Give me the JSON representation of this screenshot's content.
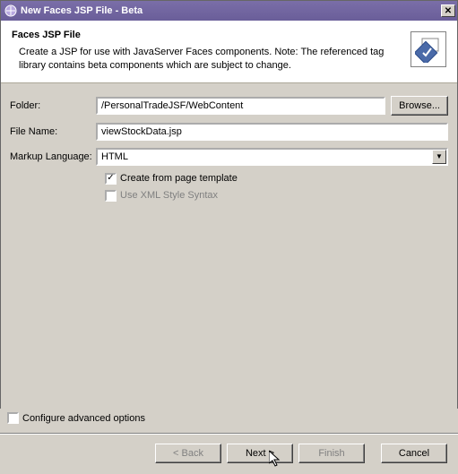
{
  "title": "New Faces JSP File - Beta",
  "header": {
    "title": "Faces JSP File",
    "desc": "Create a JSP for use with JavaServer Faces components.  Note:  The referenced tag library contains beta components which are subject to change."
  },
  "form": {
    "folder_label": "Folder:",
    "folder_value": "/PersonalTradeJSF/WebContent",
    "browse_label": "Browse...",
    "filename_label": "File Name:",
    "filename_value": "viewStockData.jsp",
    "markup_label": "Markup Language:",
    "markup_value": "HTML",
    "create_template_label": "Create from page template",
    "create_template_checked": true,
    "xml_syntax_label": "Use XML Style Syntax",
    "xml_syntax_checked": false
  },
  "advanced": {
    "label": "Configure advanced options",
    "checked": false
  },
  "buttons": {
    "back": "< Back",
    "next": "Next >",
    "finish": "Finish",
    "cancel": "Cancel"
  }
}
